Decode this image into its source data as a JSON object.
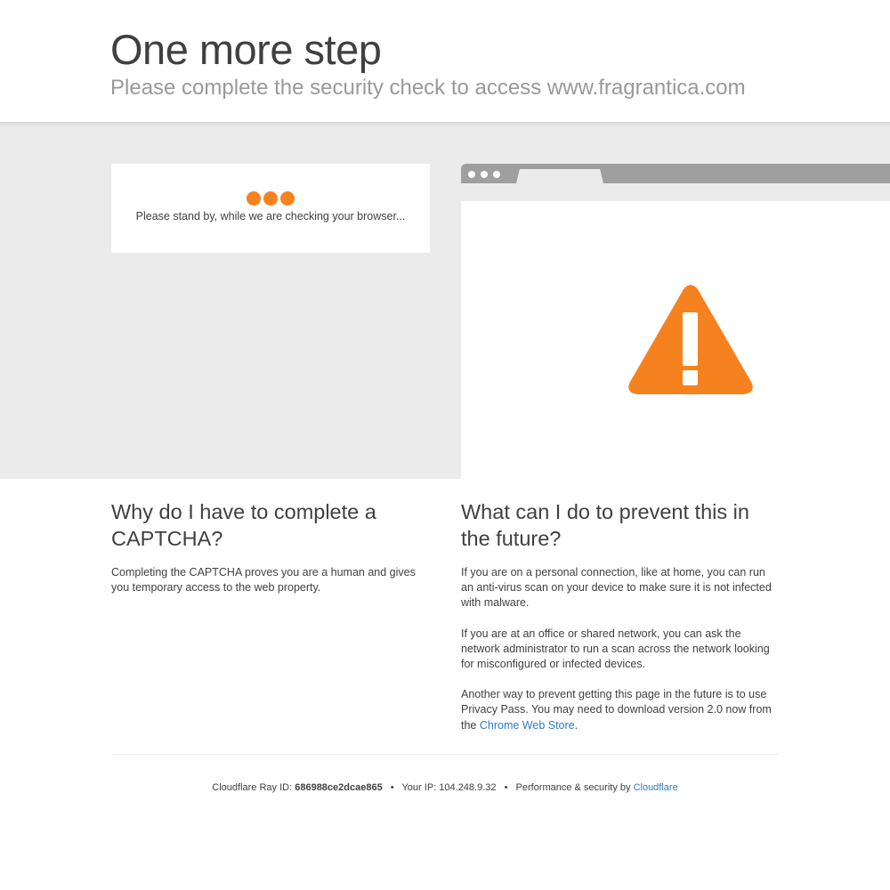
{
  "header": {
    "title": "One more step",
    "subtitle": "Please complete the security check to access www.fragrantica.com"
  },
  "standby": {
    "message": "Please stand by, while we are checking your browser..."
  },
  "icons": {
    "loading": "loading-dots-icon",
    "warning": "warning-triangle-icon"
  },
  "colors": {
    "accent": "#f6821f",
    "link": "#2f7bbf",
    "band": "#ebebeb"
  },
  "why": {
    "heading": "Why do I have to complete a CAPTCHA?",
    "body": "Completing the CAPTCHA proves you are a human and gives you temporary access to the web property."
  },
  "prevent": {
    "heading": "What can I do to prevent this in the future?",
    "p1": "If you are on a personal connection, like at home, you can run an anti-virus scan on your device to make sure it is not infected with malware.",
    "p2": "If you are at an office or shared network, you can ask the network administrator to run a scan across the network looking for misconfigured or infected devices.",
    "p3_prefix": "Another way to prevent getting this page in the future is to use Privacy Pass. You may need to download version 2.0 now from the ",
    "p3_link": "Chrome Web Store",
    "p3_suffix": "."
  },
  "footer": {
    "ray_label": "Cloudflare Ray ID:",
    "ray_id": "686988ce2dcae865",
    "separator": "•",
    "ip_label": "Your IP:",
    "ip": "104.248.9.32",
    "perf_label": "Performance & security by",
    "cloudflare_link": "Cloudflare"
  }
}
